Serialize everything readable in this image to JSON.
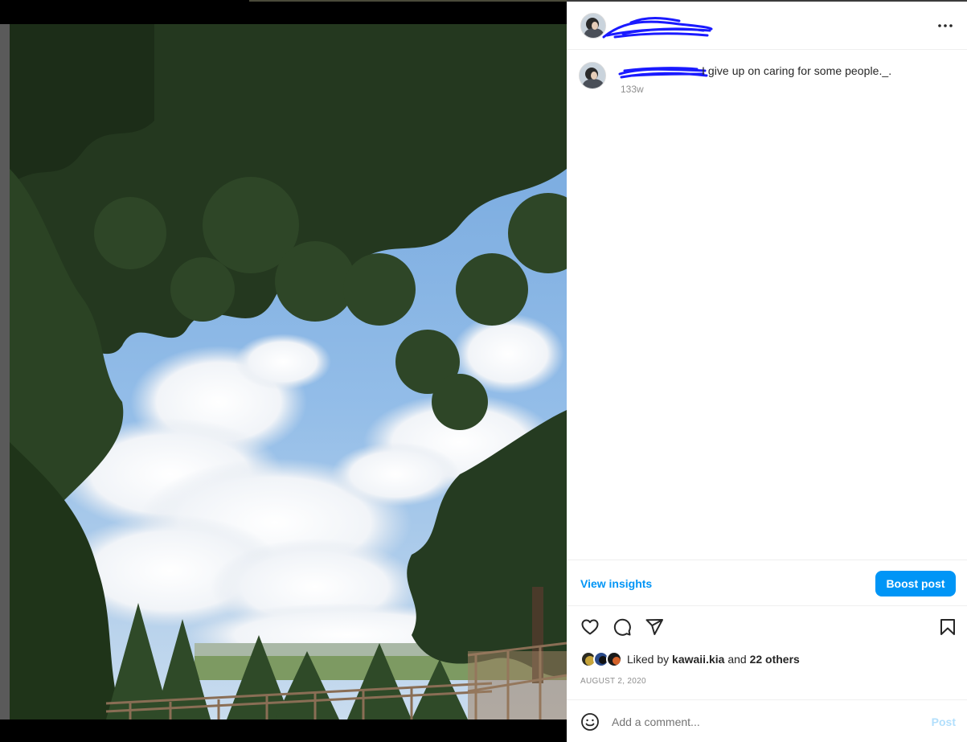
{
  "header": {
    "more_options_icon": "more-horizontal-icon"
  },
  "caption": {
    "text": "I give up on caring for some people._.",
    "timestamp": "133w"
  },
  "insights": {
    "view_insights_label": "View insights",
    "boost_post_label": "Boost post"
  },
  "actions": {
    "like_icon": "heart-icon",
    "comment_icon": "comment-icon",
    "share_icon": "share-icon",
    "save_icon": "bookmark-icon"
  },
  "likes": {
    "prefix": "Liked by",
    "user": "kawaii.kia",
    "connector": "and",
    "others": "22 others"
  },
  "post_date": "AUGUST 2, 2020",
  "comment": {
    "placeholder": "Add a comment...",
    "post_label": "Post"
  },
  "colors": {
    "accent": "#0095f6",
    "post_disabled": "#b2dffc",
    "redaction": "#1a1aff"
  }
}
